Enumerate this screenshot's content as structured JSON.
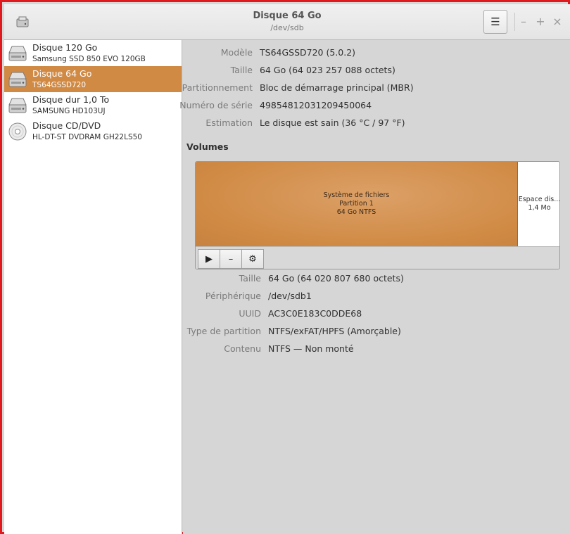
{
  "window": {
    "title": "Disque 64 Go",
    "subtitle": "/dev/sdb",
    "menu_icon": "☰",
    "minimize": "–",
    "maximize": "+",
    "close": "×"
  },
  "drives": [
    {
      "name": "Disque 120 Go",
      "model": "Samsung SSD 850 EVO 120GB",
      "icon": "hard-disk-icon",
      "selected": false
    },
    {
      "name": "Disque 64 Go",
      "model": "TS64GSSD720",
      "icon": "hard-disk-icon",
      "selected": true
    },
    {
      "name": "Disque dur 1,0 To",
      "model": "SAMSUNG HD103UJ",
      "icon": "hard-disk-icon",
      "selected": false
    },
    {
      "name": "Disque CD/DVD",
      "model": "HL-DT-ST DVDRAM GH22LS50",
      "icon": "optical-disc-icon",
      "selected": false
    }
  ],
  "disk_properties": [
    {
      "label": "Modèle",
      "value": "TS64GSSD720 (5.0.2)"
    },
    {
      "label": "Taille",
      "value": "64 Go (64 023 257 088 octets)"
    },
    {
      "label": "Partitionnement",
      "value": "Bloc de démarrage principal (MBR)"
    },
    {
      "label": "Numéro de série",
      "value": "49854812031209450064"
    },
    {
      "label": "Estimation",
      "value": "Le disque est sain (36 °C / 97 °F)"
    }
  ],
  "volumes": {
    "title": "Volumes",
    "partition": {
      "line1": "Système de fichiers",
      "line2": "Partition 1",
      "line3": "64 Go NTFS"
    },
    "free_space": {
      "line1": "Espace dis...",
      "line2": "1,4 Mo"
    },
    "toolbar": {
      "play": "▶",
      "remove": "–",
      "settings": "⚙"
    }
  },
  "volume_properties": [
    {
      "label": "Taille",
      "value": "64 Go (64 020 807 680 octets)"
    },
    {
      "label": "Périphérique",
      "value": "/dev/sdb1"
    },
    {
      "label": "UUID",
      "value": "AC3C0E183C0DDE68"
    },
    {
      "label": "Type de partition",
      "value": "NTFS/exFAT/HPFS (Amorçable)"
    },
    {
      "label": "Contenu",
      "value": "NTFS — Non monté"
    }
  ],
  "colors": {
    "selection": "#d08a44",
    "frame": "#e0191e"
  }
}
